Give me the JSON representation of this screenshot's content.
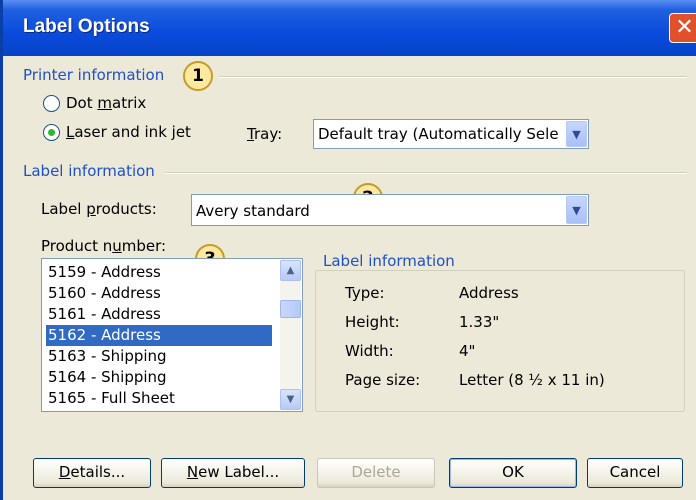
{
  "window": {
    "title": "Label Options",
    "close_glyph": "✕"
  },
  "printer_info": {
    "heading": "Printer information",
    "callout": "1",
    "dot_matrix": {
      "accel": "m",
      "before": "Dot ",
      "after": "atrix",
      "checked": false
    },
    "laser": {
      "accel": "L",
      "before": "",
      "after": "aser and ink jet",
      "checked": true
    },
    "tray_label": {
      "accel": "T",
      "after": "ray:"
    },
    "tray_value": "Default tray (Automatically Sele"
  },
  "label_info": {
    "heading": "Label information",
    "callout": "2",
    "products_label": {
      "before": "Label ",
      "accel": "p",
      "after": "roducts:"
    },
    "products_value": "Avery standard"
  },
  "product_number": {
    "label": {
      "before": "Product n",
      "accel": "u",
      "after": "mber:"
    },
    "callout": "3",
    "items": [
      "5159 - Address",
      "5160 - Address",
      "5161 - Address",
      "5162 - Address",
      "5163 - Shipping",
      "5164 - Shipping",
      "5165 - Full Sheet"
    ],
    "selected_index": 3
  },
  "details_box": {
    "heading": "Label information",
    "type_label": "Type:",
    "type_value": "Address",
    "height_label": "Height:",
    "height_value": "1.33\"",
    "width_label": "Width:",
    "width_value": "4\"",
    "pagesize_label": "Page size:",
    "pagesize_value": "Letter (8 ½ x 11 in)"
  },
  "buttons": {
    "details": {
      "accel": "D",
      "after": "etails..."
    },
    "new_label": {
      "accel": "N",
      "after": "ew Label..."
    },
    "delete": "Delete",
    "ok": "OK",
    "cancel": "Cancel"
  },
  "colors": {
    "title_bar": "#0a4bdc",
    "group_heading": "#1e50c8",
    "selection": "#316ac5",
    "close_button": "#e0502a",
    "callout_fill": "#ffe9a0"
  }
}
